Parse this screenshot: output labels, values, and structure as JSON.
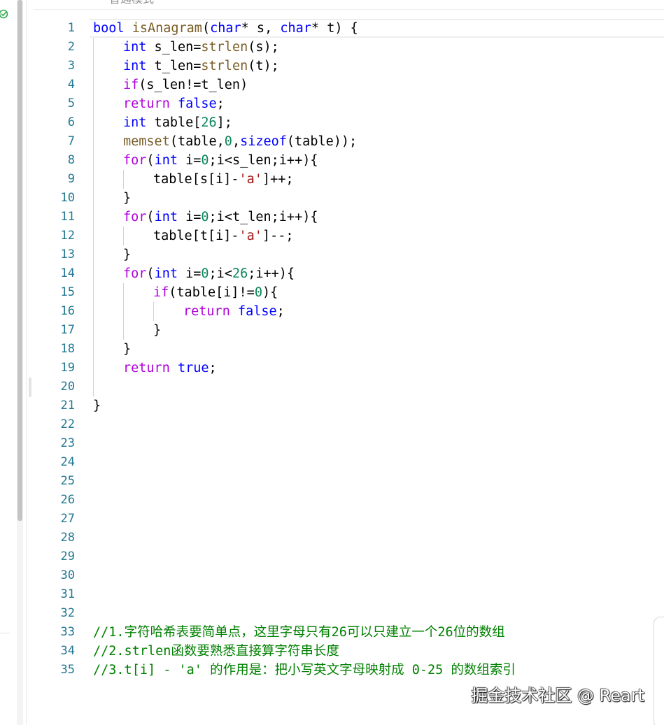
{
  "header": {
    "mode_text": "普通模式"
  },
  "status": {
    "check_icon": "check-circle-icon",
    "color": "#2eaa4c"
  },
  "editor": {
    "line_numbers": [
      "1",
      "2",
      "3",
      "4",
      "5",
      "6",
      "7",
      "8",
      "9",
      "10",
      "11",
      "12",
      "13",
      "14",
      "15",
      "16",
      "17",
      "18",
      "19",
      "20",
      "21",
      "22",
      "23",
      "24",
      "25",
      "26",
      "27",
      "28",
      "29",
      "30",
      "31",
      "32",
      "33",
      "34",
      "35"
    ],
    "code": {
      "l1": {
        "t1": "bool",
        "t2": " ",
        "t3": "isAnagram",
        "t4": "(",
        "t5": "char",
        "t6": "* s, ",
        "t7": "char",
        "t8": "* t) {"
      },
      "l2": {
        "t1": "int",
        "t2": " s_len=",
        "t3": "strlen",
        "t4": "(s);"
      },
      "l3": {
        "t1": "int",
        "t2": " t_len=",
        "t3": "strlen",
        "t4": "(t);"
      },
      "l4": {
        "t1": "if",
        "t2": "(s_len!=t_len)"
      },
      "l5": {
        "t1": "return",
        "t2": " ",
        "t3": "false",
        "t4": ";"
      },
      "l6": {
        "t1": "int",
        "t2": " table[",
        "t3": "26",
        "t4": "];"
      },
      "l7": {
        "t1": "memset",
        "t2": "(table,",
        "t3": "0",
        "t4": ",",
        "t5": "sizeof",
        "t6": "(table));"
      },
      "l8": {
        "t1": "for",
        "t2": "(",
        "t3": "int",
        "t4": " i=",
        "t5": "0",
        "t6": ";i<s_len;i++){"
      },
      "l9": {
        "t1": "table[s[i]-",
        "t2": "'a'",
        "t3": "]++;"
      },
      "l10": {
        "t1": "}"
      },
      "l11": {
        "t1": "for",
        "t2": "(",
        "t3": "int",
        "t4": " i=",
        "t5": "0",
        "t6": ";i<t_len;i++){"
      },
      "l12": {
        "t1": "table[t[i]-",
        "t2": "'a'",
        "t3": "]--;"
      },
      "l13": {
        "t1": "}"
      },
      "l14": {
        "t1": "for",
        "t2": "(",
        "t3": "int",
        "t4": " i=",
        "t5": "0",
        "t6": ";i<",
        "t7": "26",
        "t8": ";i++){"
      },
      "l15": {
        "t1": "if",
        "t2": "(table[i]!=",
        "t3": "0",
        "t4": "){"
      },
      "l16": {
        "t1": "return",
        "t2": " ",
        "t3": "false",
        "t4": ";"
      },
      "l17": {
        "t1": "}"
      },
      "l18": {
        "t1": "}"
      },
      "l19": {
        "t1": "return",
        "t2": " ",
        "t3": "true",
        "t4": ";"
      },
      "l21": {
        "t1": "}"
      },
      "l33": {
        "t1": "//1.",
        "t2": "字符哈希表要简单点，这里字母只有",
        "t3": "26",
        "t4": "可以只建立一个",
        "t5": "26",
        "t6": "位的数组"
      },
      "l34": {
        "t1": "//2.strlen",
        "t2": "函数要熟悉直接算字符串长度"
      },
      "l35": {
        "t1": "//3.t[i] - 'a' ",
        "t2": "的作用是：把小写英文字母映射成",
        "t3": " 0-25 ",
        "t4": "的数组索引"
      }
    }
  },
  "watermark": {
    "text": "掘金技术社区 @ Reart"
  },
  "colors": {
    "keyword": "#0000ff",
    "control": "#af00db",
    "function": "#795e26",
    "number": "#098658",
    "string": "#a31515",
    "comment": "#008000",
    "line_number": "#237893"
  }
}
